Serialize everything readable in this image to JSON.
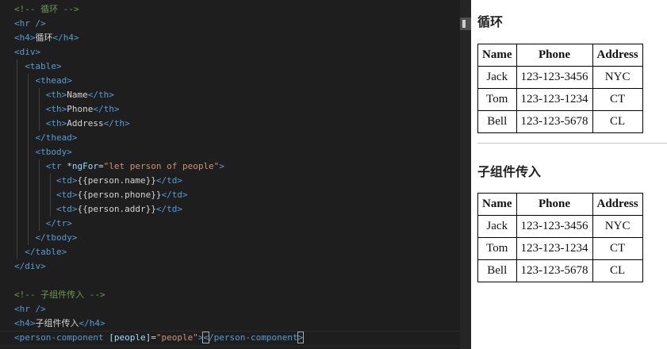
{
  "editor": {
    "lines": [
      [
        {
          "t": "<!-- 循环 -->",
          "c": "com"
        }
      ],
      [
        {
          "t": "<hr />",
          "c": "tag"
        }
      ],
      [
        {
          "t": "<h4>",
          "c": "tag"
        },
        {
          "t": "循环",
          "c": "txt"
        },
        {
          "t": "</h4>",
          "c": "tag"
        }
      ],
      [
        {
          "t": "<div>",
          "c": "tag"
        }
      ],
      [
        {
          "t": "  <table>",
          "c": "tag"
        }
      ],
      [
        {
          "t": "    <thead>",
          "c": "tag"
        }
      ],
      [
        {
          "t": "      <th>",
          "c": "tag"
        },
        {
          "t": "Name",
          "c": "txt"
        },
        {
          "t": "</th>",
          "c": "tag"
        }
      ],
      [
        {
          "t": "      <th>",
          "c": "tag"
        },
        {
          "t": "Phone",
          "c": "txt"
        },
        {
          "t": "</th>",
          "c": "tag"
        }
      ],
      [
        {
          "t": "      <th>",
          "c": "tag"
        },
        {
          "t": "Address",
          "c": "txt"
        },
        {
          "t": "</th>",
          "c": "tag"
        }
      ],
      [
        {
          "t": "    </thead>",
          "c": "tag"
        }
      ],
      [
        {
          "t": "    <tbody>",
          "c": "tag"
        }
      ],
      [
        {
          "t": "      <tr ",
          "c": "tag"
        },
        {
          "t": "*ngFor",
          "c": "attr"
        },
        {
          "t": "=",
          "c": "txt"
        },
        {
          "t": "\"let person of people\"",
          "c": "str"
        },
        {
          "t": ">",
          "c": "tag"
        }
      ],
      [
        {
          "t": "        <td>",
          "c": "tag"
        },
        {
          "t": "{{person.name}}",
          "c": "txt"
        },
        {
          "t": "</td>",
          "c": "tag"
        }
      ],
      [
        {
          "t": "        <td>",
          "c": "tag"
        },
        {
          "t": "{{person.phone}}",
          "c": "txt"
        },
        {
          "t": "</td>",
          "c": "tag"
        }
      ],
      [
        {
          "t": "        <td>",
          "c": "tag"
        },
        {
          "t": "{{person.addr}}",
          "c": "txt"
        },
        {
          "t": "</td>",
          "c": "tag"
        }
      ],
      [
        {
          "t": "      </tr>",
          "c": "tag"
        }
      ],
      [
        {
          "t": "    </tbody>",
          "c": "tag"
        }
      ],
      [
        {
          "t": "  </table>",
          "c": "tag"
        }
      ],
      [
        {
          "t": "</div>",
          "c": "tag"
        }
      ],
      [],
      [
        {
          "t": "<!-- 子组件传入 -->",
          "c": "com"
        }
      ],
      [
        {
          "t": "<hr />",
          "c": "tag"
        }
      ],
      [
        {
          "t": "<h4>",
          "c": "tag"
        },
        {
          "t": "子组件传入",
          "c": "txt"
        },
        {
          "t": "</h4>",
          "c": "tag"
        }
      ],
      [
        {
          "t": "<person-component ",
          "c": "tag"
        },
        {
          "t": "[people]",
          "c": "attr"
        },
        {
          "t": "=",
          "c": "txt"
        },
        {
          "t": "\"people\"",
          "c": "str"
        },
        {
          "t": ">",
          "c": "tag"
        },
        {
          "t": "<",
          "c": "tag",
          "box": true
        },
        {
          "t": "/person-component",
          "c": "tag"
        },
        {
          "t": ">",
          "c": "tag",
          "box": true
        }
      ]
    ]
  },
  "colors": {
    "editor_bg": "#1e1e1e",
    "comment": "#6a9955",
    "tag": "#569cd6",
    "text": "#d4d4d4",
    "attribute": "#9cdcfe",
    "string": "#ce9178"
  },
  "preview": {
    "section1": {
      "title": "循环",
      "headers": [
        "Name",
        "Phone",
        "Address"
      ],
      "rows": [
        [
          "Jack",
          "123-123-3456",
          "NYC"
        ],
        [
          "Tom",
          "123-123-1234",
          "CT"
        ],
        [
          "Bell",
          "123-123-5678",
          "CL"
        ]
      ]
    },
    "section2": {
      "title": "子组件传入",
      "headers": [
        "Name",
        "Phone",
        "Address"
      ],
      "rows": [
        [
          "Jack",
          "123-123-3456",
          "NYC"
        ],
        [
          "Tom",
          "123-123-1234",
          "CT"
        ],
        [
          "Bell",
          "123-123-5678",
          "CL"
        ]
      ]
    }
  }
}
